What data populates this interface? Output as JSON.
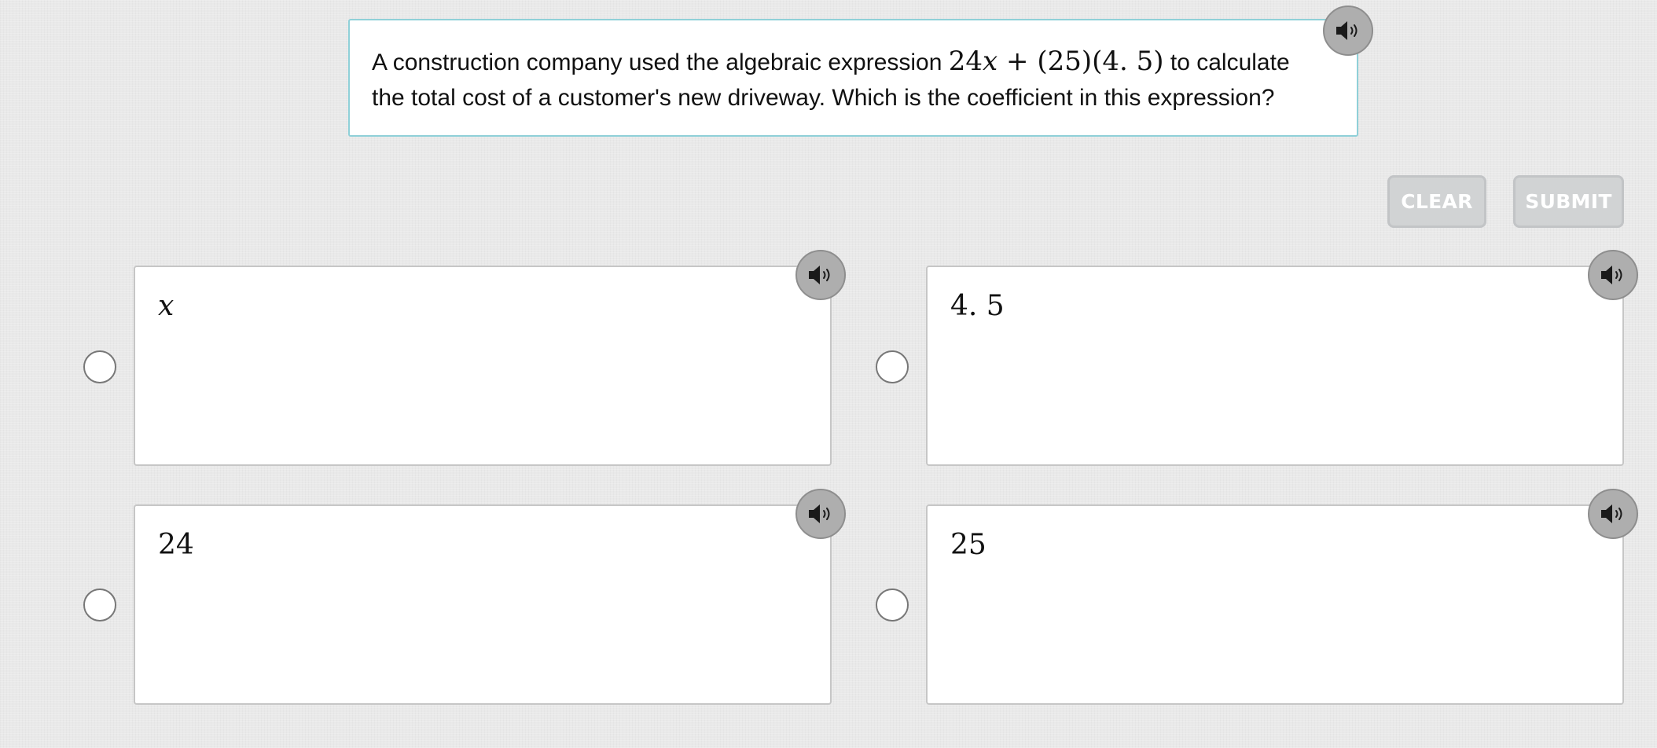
{
  "question": {
    "text_before": "A construction company used the algebraic expression",
    "expression": {
      "coef": "24",
      "var": "x",
      "rest": " + (25)(4. 5)"
    },
    "text_line1_end": " to calculate",
    "text_line2": "the total cost of a customer's new driveway. Which is the coefficient in this expression?",
    "audio_icon": "speaker-icon"
  },
  "buttons": {
    "clear_label": "CLEAR",
    "submit_label": "SUBMIT"
  },
  "answers": [
    {
      "value": "x",
      "italic": true,
      "selected": false,
      "audio_icon": "speaker-icon"
    },
    {
      "value": "4. 5",
      "italic": false,
      "selected": false,
      "audio_icon": "speaker-icon"
    },
    {
      "value": "24",
      "italic": false,
      "selected": false,
      "audio_icon": "speaker-icon"
    },
    {
      "value": "25",
      "italic": false,
      "selected": false,
      "audio_icon": "speaker-icon"
    }
  ],
  "colors": {
    "background": "#e9e9e9",
    "question_border": "#8fd0d8",
    "button_fill": "#d1d3d4",
    "speaker_fill": "#aeaeae"
  }
}
